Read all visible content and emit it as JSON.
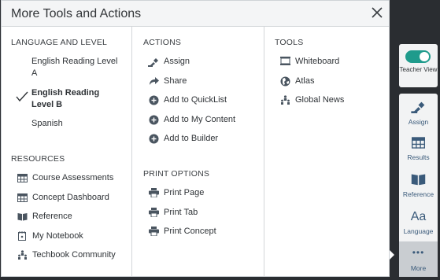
{
  "panel": {
    "title": "More Tools and Actions"
  },
  "language": {
    "heading": "LANGUAGE AND LEVEL",
    "items": [
      {
        "label": "English Reading Level A",
        "selected": false
      },
      {
        "label": "English Reading Level B",
        "selected": true
      },
      {
        "label": "Spanish",
        "selected": false
      }
    ]
  },
  "resources": {
    "heading": "RESOURCES",
    "items": [
      {
        "label": "Course Assessments",
        "icon": "table-icon"
      },
      {
        "label": "Concept Dashboard",
        "icon": "table-icon"
      },
      {
        "label": "Reference",
        "icon": "book-icon"
      },
      {
        "label": "My Notebook",
        "icon": "notebook-icon"
      },
      {
        "label": "Techbook Community",
        "icon": "community-icon"
      }
    ]
  },
  "actions": {
    "heading": "ACTIONS",
    "items": [
      {
        "label": "Assign",
        "icon": "assign-icon"
      },
      {
        "label": "Share",
        "icon": "share-icon"
      },
      {
        "label": "Add to QuickList",
        "icon": "plus-circle-icon"
      },
      {
        "label": "Add to My Content",
        "icon": "plus-circle-icon"
      },
      {
        "label": "Add to Builder",
        "icon": "plus-circle-icon"
      }
    ]
  },
  "print_options": {
    "heading": "PRINT OPTIONS",
    "items": [
      {
        "label": "Print Page",
        "icon": "printer-icon"
      },
      {
        "label": "Print Tab",
        "icon": "printer-icon"
      },
      {
        "label": "Print Concept",
        "icon": "printer-icon"
      }
    ]
  },
  "tools": {
    "heading": "TOOLS",
    "items": [
      {
        "label": "Whiteboard",
        "icon": "whiteboard-icon"
      },
      {
        "label": "Atlas",
        "icon": "globe-icon"
      },
      {
        "label": "Global News",
        "icon": "news-icon"
      }
    ]
  },
  "toolbar": {
    "teacher_view": {
      "label": "Teacher View",
      "on": true
    },
    "buttons": [
      {
        "label": "Assign",
        "icon": "assign-icon"
      },
      {
        "label": "Results",
        "icon": "table-icon"
      },
      {
        "label": "Reference",
        "icon": "book-icon"
      },
      {
        "label": "Language",
        "icon": "language-icon",
        "glyph": "Aa"
      },
      {
        "label": "More",
        "icon": "more-icon",
        "glyph": "•••",
        "active": true
      }
    ]
  },
  "colors": {
    "accent": "#1f9b8c",
    "icon": "#4a5560",
    "toolbar_label": "#3a5a7a"
  }
}
